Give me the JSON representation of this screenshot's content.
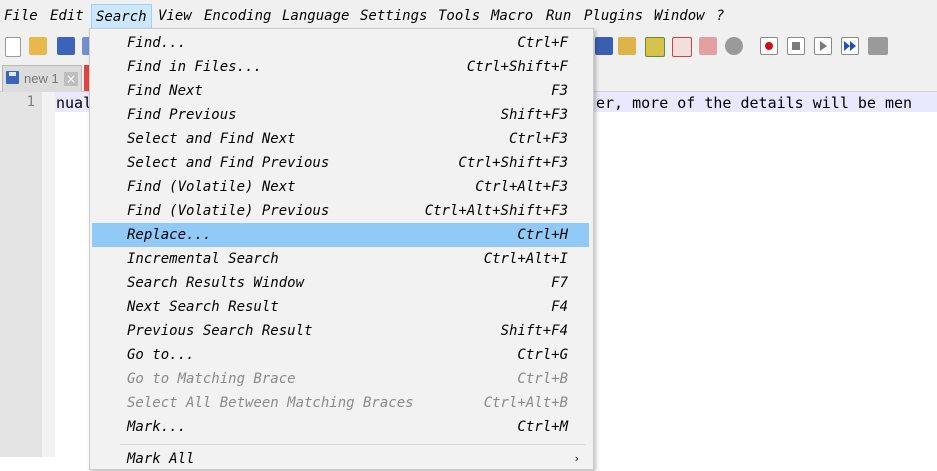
{
  "menubar": {
    "items": [
      "File",
      "Edit",
      "Search",
      "View",
      "Encoding",
      "Language",
      "Settings",
      "Tools",
      "Macro",
      "Run",
      "Plugins",
      "Window",
      "?"
    ],
    "active": "Search"
  },
  "tabs": [
    {
      "name": "new 1",
      "close": "×"
    }
  ],
  "editor": {
    "line_number": "1",
    "text_left": "nual",
    "text_right": "er, more of the details will be men"
  },
  "search_menu": {
    "items": [
      {
        "label": "Find...",
        "shortcut": "Ctrl+F"
      },
      {
        "label": "Find in Files...",
        "shortcut": "Ctrl+Shift+F"
      },
      {
        "label": "Find Next",
        "shortcut": "F3"
      },
      {
        "label": "Find Previous",
        "shortcut": "Shift+F3"
      },
      {
        "label": "Select and Find Next",
        "shortcut": "Ctrl+F3"
      },
      {
        "label": "Select and Find Previous",
        "shortcut": "Ctrl+Shift+F3"
      },
      {
        "label": "Find (Volatile) Next",
        "shortcut": "Ctrl+Alt+F3"
      },
      {
        "label": "Find (Volatile) Previous",
        "shortcut": "Ctrl+Alt+Shift+F3"
      },
      {
        "label": "Replace...",
        "shortcut": "Ctrl+H",
        "highlighted": true
      },
      {
        "label": "Incremental Search",
        "shortcut": "Ctrl+Alt+I"
      },
      {
        "label": "Search Results Window",
        "shortcut": "F7"
      },
      {
        "label": "Next Search Result",
        "shortcut": "F4"
      },
      {
        "label": "Previous Search Result",
        "shortcut": "Shift+F4"
      },
      {
        "label": "Go to...",
        "shortcut": "Ctrl+G"
      },
      {
        "label": "Go to Matching Brace",
        "shortcut": "Ctrl+B",
        "disabled": true
      },
      {
        "label": "Select All Between Matching Braces",
        "shortcut": "Ctrl+Alt+B",
        "disabled": true
      },
      {
        "label": "Mark...",
        "shortcut": "Ctrl+M"
      },
      {
        "label": "Mark All",
        "shortcut": ""
      }
    ],
    "submenu_arrow": "›"
  },
  "colors": {
    "highlight": "#91c9f7",
    "menubar_active": "#cce8ff"
  }
}
